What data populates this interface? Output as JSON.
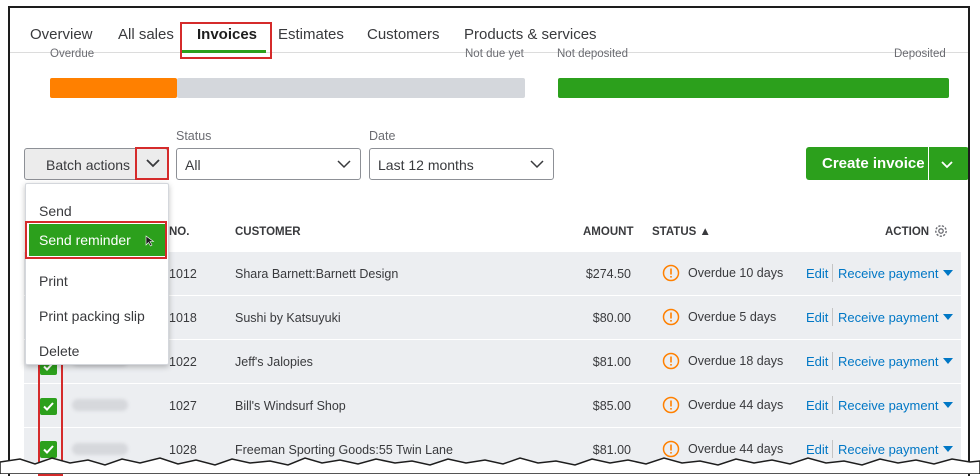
{
  "tabs": [
    "Overview",
    "All sales",
    "Invoices",
    "Estimates",
    "Customers",
    "Products & services"
  ],
  "active_tab": "Invoices",
  "summary": {
    "overdue_label": "Overdue",
    "not_due_label": "Not due yet",
    "not_deposited_label": "Not deposited",
    "deposited_label": "Deposited",
    "colors": {
      "overdue": "#ff8000",
      "not_due": "#d4d7dc",
      "deposited": "#2ca01c"
    }
  },
  "toolbar": {
    "batch_actions_label": "Batch actions",
    "status_label": "Status",
    "status_value": "All",
    "date_label": "Date",
    "date_value": "Last 12 months",
    "create_invoice_label": "Create invoice"
  },
  "batch_menu": {
    "items": [
      "Send",
      "Send reminder",
      "Print",
      "Print packing slip",
      "Delete"
    ],
    "highlighted": "Send reminder"
  },
  "table": {
    "headers": {
      "no": "NO.",
      "customer": "CUSTOMER",
      "amount": "AMOUNT",
      "status": "STATUS ▲",
      "action": "ACTION"
    },
    "rows": [
      {
        "no": "1012",
        "customer": "Shara Barnett:Barnett Design",
        "amount": "$274.50",
        "status": "Overdue 10 days",
        "edit": "Edit",
        "action": "Receive payment",
        "checked": false
      },
      {
        "no": "1018",
        "customer": "Sushi by Katsuyuki",
        "amount": "$80.00",
        "status": "Overdue 5 days",
        "edit": "Edit",
        "action": "Receive payment",
        "checked": false
      },
      {
        "no": "1022",
        "customer": "Jeff's Jalopies",
        "amount": "$81.00",
        "status": "Overdue 18 days",
        "edit": "Edit",
        "action": "Receive payment",
        "checked": true
      },
      {
        "no": "1027",
        "customer": "Bill's Windsurf Shop",
        "amount": "$85.00",
        "status": "Overdue 44 days",
        "edit": "Edit",
        "action": "Receive payment",
        "checked": true
      },
      {
        "no": "1028",
        "customer": "Freeman Sporting Goods:55 Twin Lane",
        "amount": "$81.00",
        "status": "Overdue 44 days",
        "edit": "Edit",
        "action": "Receive payment",
        "checked": true
      }
    ]
  },
  "colors": {
    "accent": "#2ca01c",
    "link": "#0077c5",
    "warning": "#ff8000",
    "highlight_box": "#d52b2b"
  }
}
